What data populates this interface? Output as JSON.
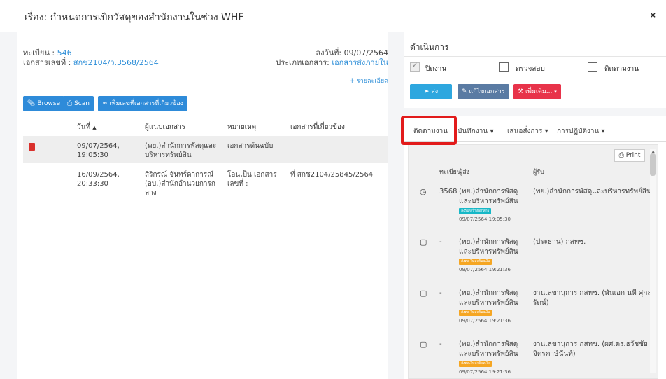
{
  "modal": {
    "title": "เรื่อง: กำหนดการเบิกวัสดุของสำนักงานในช่วง WHF",
    "close": "×"
  },
  "document": {
    "reg_label": "ทะเบียน : ",
    "reg_value": "546",
    "docno_label": "เอกสารเลขที่ : ",
    "docno_value": "สกช2104/ว.3568/2564",
    "date_label": "ลงวันที่: ",
    "date_value": "09/07/2564",
    "type_label": "ประเภทเอกสาร: ",
    "type_value": "เอกสารส่งภายใน",
    "detail_link": "+ รายละเอียด"
  },
  "buttons": {
    "browse": "Browse",
    "scan": "Scan",
    "add_related": "เพิ่มเลขที่เอกสารที่เกี่ยวข้อง"
  },
  "table": {
    "headers": [
      "วันที่",
      "ผู้แนบเอกสาร",
      "หมายเหตุ",
      "เอกสารที่เกี่ยวข้อง"
    ],
    "sort_icon": "▲",
    "rows": [
      {
        "date": "09/07/2564, 19:05:30",
        "attacher": "(พย.)สำนักการพัสดุและบริหารทรัพย์สิน",
        "note": "เอกสารต้นฉบับ",
        "related": ""
      },
      {
        "date": "16/09/2564, 20:33:30",
        "attacher": "สิริกรณ์ จันทร์ดาการณ์ (อบ.)สำนักอำนวยการกลาง",
        "note": "โอนเป็น เอกสารเลขที่ :",
        "related": "ที่ สกช2104/25845/2564"
      }
    ]
  },
  "action": {
    "heading": "ดำเนินการ",
    "checks": [
      "ปิดงาน",
      "ตรวจสอบ",
      "ติดตามงาน"
    ],
    "send": "ส่ง",
    "edit": "แก้ไขเอกสาร",
    "add": "เพิ่มเติม...",
    "colors": {
      "blue": "#2ea7df",
      "slate": "#5a7ba3",
      "red": "#e8334a"
    }
  },
  "tabs": [
    {
      "label": "ติดตามงาน"
    },
    {
      "label": "บันทึกงาน ▾"
    },
    {
      "label": "เสนอสั่งการ ▾"
    },
    {
      "label": "การปฏิบัติงาน ▾"
    }
  ],
  "tracking": {
    "print": "Print",
    "headers": [
      "ทะเบียน",
      "ผู้ส่ง",
      "ผู้รับ"
    ],
    "entries": [
      {
        "icon": "clock-icon",
        "reg": "3568",
        "sender": "(พย.)สำนักการพัสดุและบริหารทรัพย์สิน",
        "badge": "ลงรับ/สร้างเอกสาร",
        "badge_color": "teal",
        "time": "09/07/2564 19:05:30",
        "receiver": "(พย.)สำนักการพัสดุและบริหารทรัพย์สิน"
      },
      {
        "icon": "folder-icon",
        "reg": "-",
        "sender": "(พย.)สำนักการพัสดุและบริหารทรัพย์สิน",
        "badge": "ส่งต่อ-ไม่ส่งต้นฉบับ",
        "badge_color": "orange",
        "time": "09/07/2564 19:21:36",
        "receiver": "(ประธาน) กสทช."
      },
      {
        "icon": "folder-icon",
        "reg": "-",
        "sender": "(พย.)สำนักการพัสดุและบริหารทรัพย์สิน",
        "badge": "ส่งต่อ-ไม่ส่งต้นฉบับ",
        "badge_color": "orange",
        "time": "09/07/2564 19:21:36",
        "receiver": "งานเลขานุการ กสทช. (พันเอก นที ศุกลรัตน์)"
      },
      {
        "icon": "folder-icon",
        "reg": "-",
        "sender": "(พย.)สำนักการพัสดุและบริหารทรัพย์สิน",
        "badge": "ส่งต่อ-ไม่ส่งต้นฉบับ",
        "badge_color": "orange",
        "time": "09/07/2564 19:21:36",
        "receiver": "งานเลขานุการ กสทช. (ผศ.ดร.ธวัชชัย จิตรภาษ์นันท์)"
      }
    ]
  }
}
